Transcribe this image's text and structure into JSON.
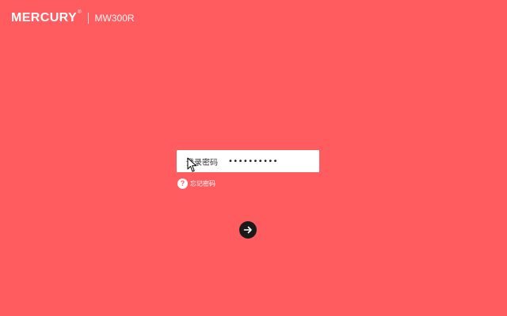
{
  "header": {
    "brand": "MERCURY",
    "trademark": "®",
    "model": "MW300R"
  },
  "login": {
    "password_label": "登录密码",
    "password_value": "••••••••••",
    "forgot_password": "忘记密码",
    "help_glyph": "?"
  },
  "icons": {
    "help": "question-circle-icon",
    "submit": "arrow-right-icon",
    "cursor": "mouse-pointer-icon"
  },
  "colors": {
    "background": "#FF5C5F",
    "card": "#FFFFFF",
    "submit_button": "#1A1A1A"
  }
}
